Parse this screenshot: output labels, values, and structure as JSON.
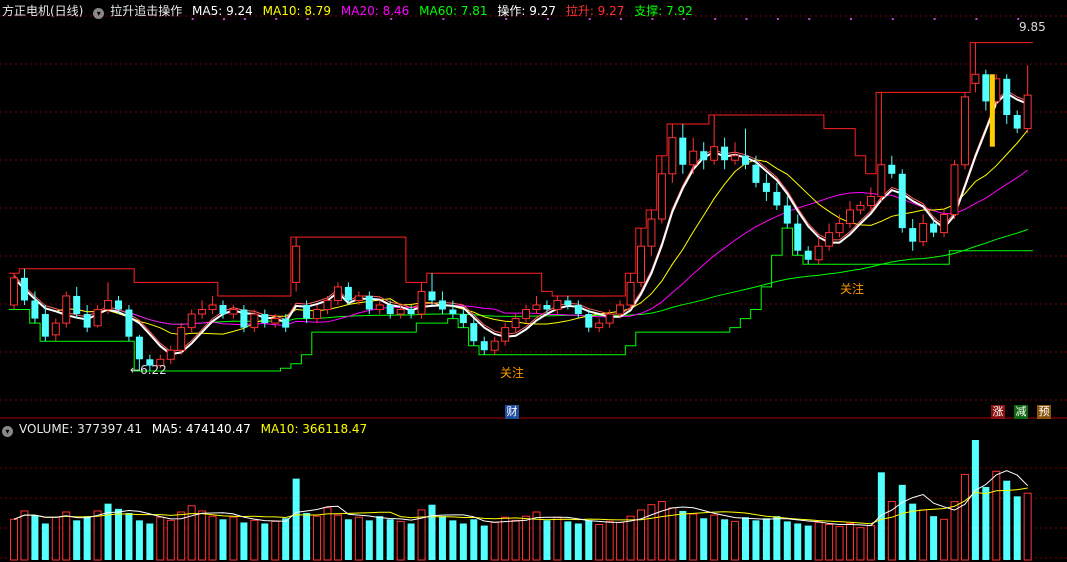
{
  "main_header": {
    "title": "方正电机(日线)",
    "indicator_name": "拉升追击操作",
    "ma5": "MA5: 9.24",
    "ma10": "MA10: 8.79",
    "ma20": "MA20: 8.46",
    "ma60": "MA60: 7.81",
    "op": "操作: 9.27",
    "lashing": "拉升: 9.27",
    "support": "支撑: 7.92"
  },
  "volume_header": {
    "volume": "VOLUME: 377397.41",
    "ma5": "MA5: 474140.47",
    "ma10": "MA10: 366118.47"
  },
  "annotations": {
    "low_price": "6.22",
    "high_price": "9.85",
    "focus_1": "关注",
    "focus_2": "关注"
  },
  "badges": {
    "finance": "财",
    "rise": "涨",
    "drop": "减",
    "forecast": "预"
  },
  "icons": {
    "settings": "gear-icon"
  },
  "colors": {
    "up": "#ff3232",
    "down": "#54ffff",
    "ma5": "#ffffff",
    "ma10": "#ffff00",
    "ma20": "#ff00ff",
    "ma60": "#00ff00",
    "resistance": "#ff2020",
    "support_line": "#00ff00",
    "orange": "#ff9900",
    "grid": "#7a0000"
  },
  "chart_data": [
    {
      "type": "candlestick",
      "title": "方正电机(日线)",
      "ylim": [
        5.9,
        10.1
      ],
      "min_label": 6.22,
      "max_label": 9.85,
      "candles": [
        [
          6.95,
          7.25,
          7.3,
          6.9
        ],
        [
          7.25,
          7.0,
          7.35,
          6.95
        ],
        [
          7.0,
          6.8,
          7.1,
          6.75
        ],
        [
          6.85,
          6.6,
          6.95,
          6.55
        ],
        [
          6.62,
          6.75,
          6.8,
          6.55
        ],
        [
          6.75,
          7.05,
          7.1,
          6.7
        ],
        [
          7.05,
          6.85,
          7.15,
          6.8
        ],
        [
          6.85,
          6.7,
          6.95,
          6.65
        ],
        [
          6.72,
          6.9,
          6.95,
          6.7
        ],
        [
          6.9,
          7.0,
          7.2,
          6.85
        ],
        [
          7.0,
          6.9,
          7.05,
          6.85
        ],
        [
          6.9,
          6.6,
          6.95,
          6.55
        ],
        [
          6.6,
          6.35,
          6.62,
          6.22
        ],
        [
          6.35,
          6.28,
          6.4,
          6.22
        ],
        [
          6.28,
          6.35,
          6.4,
          6.25
        ],
        [
          6.35,
          6.45,
          6.5,
          6.3
        ],
        [
          6.45,
          6.7,
          6.75,
          6.4
        ],
        [
          6.7,
          6.85,
          6.9,
          6.65
        ],
        [
          6.85,
          6.9,
          7.0,
          6.8
        ],
        [
          6.9,
          6.95,
          7.05,
          6.85
        ],
        [
          6.95,
          6.85,
          7.0,
          6.8
        ],
        [
          6.85,
          6.9,
          6.95,
          6.8
        ],
        [
          6.9,
          6.7,
          6.95,
          6.65
        ],
        [
          6.7,
          6.85,
          6.9,
          6.65
        ],
        [
          6.85,
          6.75,
          6.9,
          6.7
        ],
        [
          6.75,
          6.8,
          6.85,
          6.7
        ],
        [
          6.8,
          6.7,
          6.85,
          6.65
        ],
        [
          7.2,
          7.6,
          7.7,
          7.1
        ],
        [
          6.95,
          6.8,
          7.0,
          6.75
        ],
        [
          6.8,
          6.9,
          6.95,
          6.75
        ],
        [
          6.9,
          7.0,
          7.05,
          6.85
        ],
        [
          7.0,
          7.15,
          7.2,
          6.95
        ],
        [
          7.15,
          7.0,
          7.2,
          6.95
        ],
        [
          7.0,
          7.05,
          7.1,
          6.95
        ],
        [
          7.05,
          6.9,
          7.1,
          6.85
        ],
        [
          6.9,
          6.95,
          7.0,
          6.85
        ],
        [
          6.95,
          6.85,
          7.0,
          6.8
        ],
        [
          6.85,
          6.9,
          6.95,
          6.8
        ],
        [
          6.9,
          6.85,
          6.95,
          6.8
        ],
        [
          6.85,
          7.1,
          7.2,
          6.8
        ],
        [
          7.1,
          7.0,
          7.3,
          6.95
        ],
        [
          7.0,
          6.9,
          7.1,
          6.85
        ],
        [
          6.9,
          6.85,
          7.0,
          6.8
        ],
        [
          6.85,
          6.75,
          6.9,
          6.7
        ],
        [
          6.75,
          6.55,
          6.8,
          6.5
        ],
        [
          6.55,
          6.45,
          6.6,
          6.4
        ],
        [
          6.45,
          6.55,
          6.6,
          6.4
        ],
        [
          6.55,
          6.7,
          6.75,
          6.5
        ],
        [
          6.7,
          6.8,
          6.85,
          6.65
        ],
        [
          6.8,
          6.9,
          6.95,
          6.75
        ],
        [
          6.9,
          6.95,
          7.05,
          6.85
        ],
        [
          6.95,
          6.9,
          7.0,
          6.85
        ],
        [
          6.9,
          7.0,
          7.05,
          6.85
        ],
        [
          7.0,
          6.95,
          7.05,
          6.9
        ],
        [
          6.95,
          6.85,
          7.0,
          6.8
        ],
        [
          6.85,
          6.7,
          6.9,
          6.65
        ],
        [
          6.7,
          6.75,
          6.8,
          6.65
        ],
        [
          6.75,
          6.85,
          6.9,
          6.7
        ],
        [
          6.85,
          6.95,
          7.0,
          6.8
        ],
        [
          6.95,
          7.2,
          7.3,
          6.9
        ],
        [
          7.2,
          7.6,
          7.8,
          7.15
        ],
        [
          7.6,
          7.9,
          8.0,
          7.5
        ],
        [
          7.9,
          8.4,
          8.6,
          7.85
        ],
        [
          8.4,
          8.8,
          8.95,
          8.3
        ],
        [
          8.8,
          8.5,
          8.95,
          8.4
        ],
        [
          8.5,
          8.65,
          8.8,
          8.4
        ],
        [
          8.65,
          8.55,
          8.75,
          8.45
        ],
        [
          8.55,
          8.7,
          9.05,
          8.5
        ],
        [
          8.7,
          8.55,
          8.8,
          8.45
        ],
        [
          8.55,
          8.6,
          8.75,
          8.5
        ],
        [
          8.6,
          8.5,
          8.9,
          8.45
        ],
        [
          8.5,
          8.3,
          8.6,
          8.25
        ],
        [
          8.3,
          8.2,
          8.4,
          8.1
        ],
        [
          8.2,
          8.05,
          8.3,
          8.0
        ],
        [
          8.05,
          7.85,
          8.15,
          7.8
        ],
        [
          7.85,
          7.55,
          7.95,
          7.5
        ],
        [
          7.55,
          7.45,
          7.6,
          7.4
        ],
        [
          7.45,
          7.6,
          7.7,
          7.4
        ],
        [
          7.6,
          7.75,
          7.85,
          7.55
        ],
        [
          7.75,
          7.85,
          7.95,
          7.7
        ],
        [
          7.85,
          8.0,
          8.1,
          7.8
        ],
        [
          8.0,
          8.05,
          8.1,
          7.95
        ],
        [
          8.05,
          8.15,
          8.25,
          8.0
        ],
        [
          8.15,
          8.5,
          9.3,
          8.1
        ],
        [
          8.5,
          8.4,
          8.6,
          8.35
        ],
        [
          8.4,
          7.8,
          8.45,
          7.75
        ],
        [
          7.8,
          7.65,
          7.9,
          7.55
        ],
        [
          7.65,
          7.85,
          7.95,
          7.6
        ],
        [
          7.85,
          7.75,
          7.9,
          7.7
        ],
        [
          7.75,
          7.95,
          8.0,
          7.7
        ],
        [
          7.95,
          8.5,
          8.55,
          7.9
        ],
        [
          8.5,
          9.25,
          9.3,
          8.45
        ],
        [
          9.4,
          9.5,
          9.85,
          9.3
        ],
        [
          9.5,
          9.2,
          9.55,
          9.1
        ],
        [
          9.2,
          9.45,
          9.5,
          9.15
        ],
        [
          9.45,
          9.05,
          9.5,
          8.95
        ],
        [
          9.05,
          8.9,
          9.1,
          8.85
        ],
        [
          8.9,
          9.27,
          9.6,
          8.85
        ]
      ],
      "volume": [
        [
          390000,
          "up"
        ],
        [
          470000,
          "up"
        ],
        [
          430000,
          "down"
        ],
        [
          350000,
          "down"
        ],
        [
          410000,
          "up"
        ],
        [
          460000,
          "up"
        ],
        [
          380000,
          "down"
        ],
        [
          420000,
          "down"
        ],
        [
          470000,
          "up"
        ],
        [
          540000,
          "down"
        ],
        [
          490000,
          "down"
        ],
        [
          450000,
          "down"
        ],
        [
          380000,
          "down"
        ],
        [
          350000,
          "down"
        ],
        [
          410000,
          "up"
        ],
        [
          380000,
          "up"
        ],
        [
          460000,
          "up"
        ],
        [
          520000,
          "up"
        ],
        [
          470000,
          "up"
        ],
        [
          420000,
          "up"
        ],
        [
          390000,
          "down"
        ],
        [
          410000,
          "up"
        ],
        [
          360000,
          "down"
        ],
        [
          380000,
          "up"
        ],
        [
          350000,
          "down"
        ],
        [
          370000,
          "up"
        ],
        [
          400000,
          "down"
        ],
        [
          780000,
          "down"
        ],
        [
          450000,
          "down"
        ],
        [
          420000,
          "up"
        ],
        [
          500000,
          "up"
        ],
        [
          430000,
          "up"
        ],
        [
          390000,
          "down"
        ],
        [
          410000,
          "up"
        ],
        [
          380000,
          "down"
        ],
        [
          420000,
          "down"
        ],
        [
          390000,
          "down"
        ],
        [
          370000,
          "up"
        ],
        [
          350000,
          "down"
        ],
        [
          480000,
          "up"
        ],
        [
          530000,
          "down"
        ],
        [
          420000,
          "down"
        ],
        [
          380000,
          "down"
        ],
        [
          350000,
          "down"
        ],
        [
          390000,
          "down"
        ],
        [
          330000,
          "down"
        ],
        [
          360000,
          "up"
        ],
        [
          410000,
          "up"
        ],
        [
          380000,
          "up"
        ],
        [
          420000,
          "up"
        ],
        [
          460000,
          "up"
        ],
        [
          380000,
          "down"
        ],
        [
          410000,
          "up"
        ],
        [
          370000,
          "down"
        ],
        [
          350000,
          "down"
        ],
        [
          380000,
          "down"
        ],
        [
          340000,
          "up"
        ],
        [
          370000,
          "up"
        ],
        [
          360000,
          "up"
        ],
        [
          420000,
          "up"
        ],
        [
          480000,
          "up"
        ],
        [
          530000,
          "up"
        ],
        [
          560000,
          "up"
        ],
        [
          500000,
          "up"
        ],
        [
          470000,
          "down"
        ],
        [
          440000,
          "up"
        ],
        [
          400000,
          "down"
        ],
        [
          430000,
          "up"
        ],
        [
          390000,
          "down"
        ],
        [
          370000,
          "up"
        ],
        [
          410000,
          "down"
        ],
        [
          380000,
          "down"
        ],
        [
          400000,
          "down"
        ],
        [
          420000,
          "down"
        ],
        [
          370000,
          "down"
        ],
        [
          350000,
          "down"
        ],
        [
          330000,
          "down"
        ],
        [
          360000,
          "up"
        ],
        [
          340000,
          "up"
        ],
        [
          320000,
          "up"
        ],
        [
          350000,
          "up"
        ],
        [
          310000,
          "up"
        ],
        [
          330000,
          "up"
        ],
        [
          840000,
          "down"
        ],
        [
          560000,
          "up"
        ],
        [
          720000,
          "down"
        ],
        [
          540000,
          "down"
        ],
        [
          480000,
          "up"
        ],
        [
          420000,
          "down"
        ],
        [
          390000,
          "up"
        ],
        [
          560000,
          "up"
        ],
        [
          820000,
          "up"
        ],
        [
          1150000,
          "down"
        ],
        [
          700000,
          "down"
        ],
        [
          850000,
          "up"
        ],
        [
          760000,
          "down"
        ],
        [
          610000,
          "down"
        ],
        [
          640000,
          "up"
        ]
      ]
    }
  ]
}
